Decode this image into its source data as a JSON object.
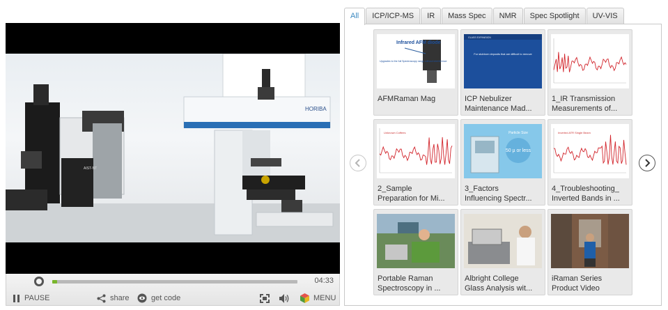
{
  "player": {
    "duration": "04:33",
    "progress_fraction": 0.02,
    "controls": {
      "pause_label": "PAUSE",
      "share_label": "share",
      "get_code_label": "get code",
      "menu_label": "MENU"
    },
    "scene_text": {
      "brand": "HORIBA",
      "tag": "AIST-NT"
    }
  },
  "tabs": [
    {
      "label": "All",
      "active": true
    },
    {
      "label": "ICP/ICP-MS",
      "active": false
    },
    {
      "label": "IR",
      "active": false
    },
    {
      "label": "Mass Spec",
      "active": false
    },
    {
      "label": "NMR",
      "active": false
    },
    {
      "label": "Spec Spotlight",
      "active": false
    },
    {
      "label": "UV-VIS",
      "active": false
    }
  ],
  "videos": [
    {
      "line1": "AFMRaman Mag",
      "line2": "",
      "thumb_text": "Infrared AFM diode",
      "thumb_sub": "Upgrades to the full Spectroscopy range without interference"
    },
    {
      "line1": "ICP Nebulizer",
      "line2": "Maintenance Mad...",
      "thumb_text": "For stubborn deposits that are difficult to remove",
      "thumb_sub": "GLASS EXPANSION"
    },
    {
      "line1": "1_IR Transmission",
      "line2": "Measurements of...",
      "thumb_text": "",
      "thumb_sub": ""
    },
    {
      "line1": "2_Sample",
      "line2": "Preparation for Mi...",
      "thumb_text": "Unknown Coffees",
      "thumb_sub": ""
    },
    {
      "line1": "3_Factors",
      "line2": "Influencing Spectr...",
      "thumb_text": "Particle Size",
      "thumb_sub": "50 µ or less"
    },
    {
      "line1": "4_Troubleshooting_",
      "line2": "Inverted Bands in ...",
      "thumb_text": "Inverted ATR Single Beam",
      "thumb_sub": ""
    },
    {
      "line1": "Portable Raman",
      "line2": "Spectroscopy in ...",
      "thumb_text": "",
      "thumb_sub": ""
    },
    {
      "line1": "Albright College",
      "line2": "Glass Analysis wit...",
      "thumb_text": "",
      "thumb_sub": ""
    },
    {
      "line1": "iRaman Series",
      "line2": "Product Video",
      "thumb_text": "",
      "thumb_sub": ""
    }
  ],
  "colors": {
    "accent_green": "#79b62c",
    "tab_active_text": "#3a88c0",
    "spectrum_red": "#d2232a",
    "blue_slide": "#1c4f9c"
  },
  "icons": {
    "pause": "pause-icon",
    "share": "share-icon",
    "get_code": "eye-icon",
    "fullscreen": "fullscreen-icon",
    "volume": "volume-icon",
    "menu": "menu-cube-icon",
    "prev": "chevron-left-icon",
    "next": "chevron-right-icon"
  }
}
